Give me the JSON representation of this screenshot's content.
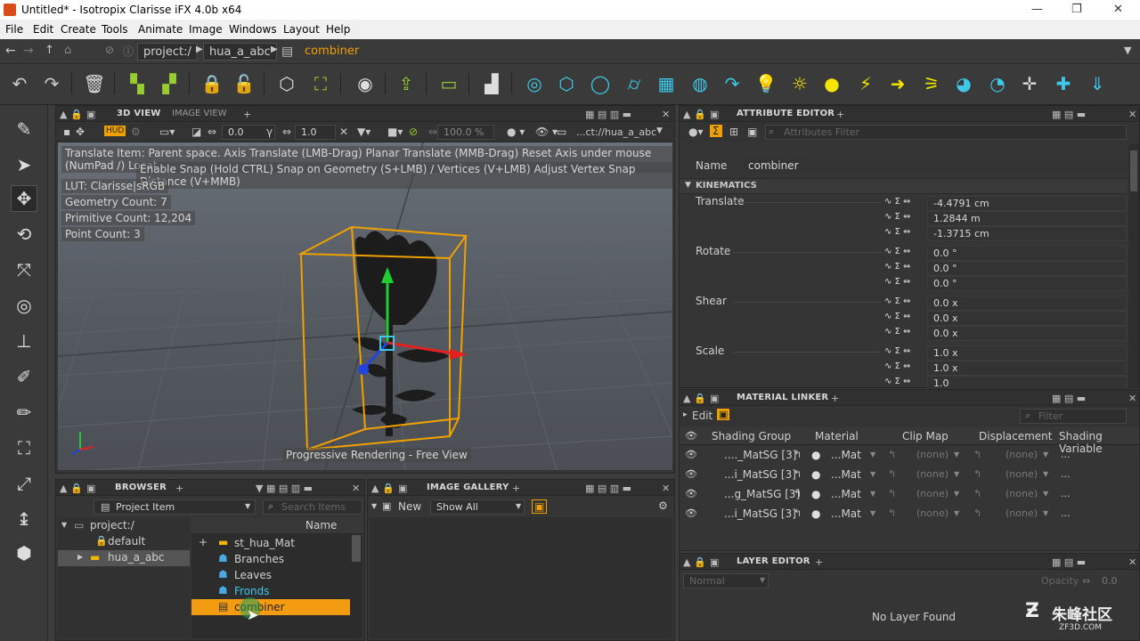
{
  "window": {
    "title": "Untitled* - Isotropix Clarisse iFX 4.0b x64",
    "minimize": "—",
    "restore": "❐",
    "close": "✕"
  },
  "menu": [
    "File",
    "Edit",
    "Create",
    "Tools",
    "Animate",
    "Image",
    "Windows",
    "Layout",
    "Help"
  ],
  "address": {
    "root": "project:/",
    "item": "hua_a_abc",
    "current": "combiner"
  },
  "viewport_panel": {
    "tab_active": "3D VIEW",
    "tab_other": "IMAGE VIEW",
    "plus": "+",
    "hud": "HUD",
    "val1": "0.0",
    "val2": "1.0",
    "zoom": "100.0 %",
    "path": "...ct://hua_a_abc"
  },
  "viewport": {
    "help1": "Translate Item: Parent space. Axis Translate (LMB-Drag)  Planar Translate (MMB-Drag) Reset Axis under mouse (NumPad /)  Locat",
    "help2": "Enable Snap (Hold CTRL) Snap on Geometry (S+LMB) / Vertices (V+LMB) Adjust Vertex Snap Distance (V+MMB)",
    "lut": "LUT: Clarisse|sRGB",
    "geometry_count": "Geometry Count: 7",
    "primitive_count": "Primitive Count: 12,204",
    "point_count": "Point Count: 3",
    "status": "Progressive Rendering - Free View"
  },
  "attribute_editor": {
    "tab": "ATTRIBUTE EDITOR",
    "plus": "+",
    "filter_placeholder": "Attributes Filter",
    "name_label": "Name",
    "name_value": "combiner",
    "section": "KINEMATICS",
    "groups": [
      {
        "label": "Translate",
        "values": [
          "-4.4791 cm",
          "1.2844 m",
          "-1.3715 cm"
        ]
      },
      {
        "label": "Rotate",
        "values": [
          "0.0 °",
          "0.0 °",
          "0.0 °"
        ]
      },
      {
        "label": "Shear",
        "values": [
          "0.0 x",
          "0.0 x",
          "0.0 x"
        ]
      },
      {
        "label": "Scale",
        "values": [
          "1.0 x",
          "1.0 x",
          "1.0"
        ]
      }
    ]
  },
  "material_linker": {
    "tab": "MATERIAL LINKER",
    "plus": "+",
    "edit": "Edit",
    "filter_placeholder": "Filter",
    "columns": [
      "Shading Group",
      "Material",
      "Clip Map",
      "Displacement",
      "Shading Variable"
    ],
    "rows": [
      {
        "group": "...._MatSG [3]",
        "material": "...Mat",
        "clip": "(none)",
        "disp": "(none)",
        "var": "..."
      },
      {
        "group": "...i_MatSG [3]",
        "material": "...Mat",
        "clip": "(none)",
        "disp": "(none)",
        "var": "..."
      },
      {
        "group": "...g_MatSG [3]",
        "material": "...Mat",
        "clip": "(none)",
        "disp": "(none)",
        "var": "..."
      },
      {
        "group": "...i_MatSG [3]",
        "material": "...Mat",
        "clip": "(none)",
        "disp": "(none)",
        "var": "..."
      }
    ]
  },
  "layer_editor": {
    "tab": "LAYER EDITOR",
    "plus": "+",
    "blend": "Normal",
    "opacity_label": "Opacity",
    "opacity": "0.0",
    "empty": "No Layer Found"
  },
  "browser": {
    "tab": "BROWSER",
    "plus": "+",
    "type": "Project Item",
    "search_placeholder": "Search Items",
    "col_name": "Name",
    "tree": [
      "project:/",
      "default",
      "hua_a_abc"
    ],
    "items": [
      "st_hua_Mat",
      "Branches",
      "Leaves",
      "Fronds",
      "combiner"
    ]
  },
  "image_gallery": {
    "tab": "IMAGE GALLERY",
    "plus": "+",
    "new": "New",
    "show": "Show All"
  },
  "watermark": {
    "brand": "朱峰社区",
    "url": "ZF3D.COM"
  },
  "colors": {
    "accent": "#f0a000",
    "selection": "#f39c12",
    "cyan": "#3fc8e8",
    "yellow": "#f5e600"
  }
}
